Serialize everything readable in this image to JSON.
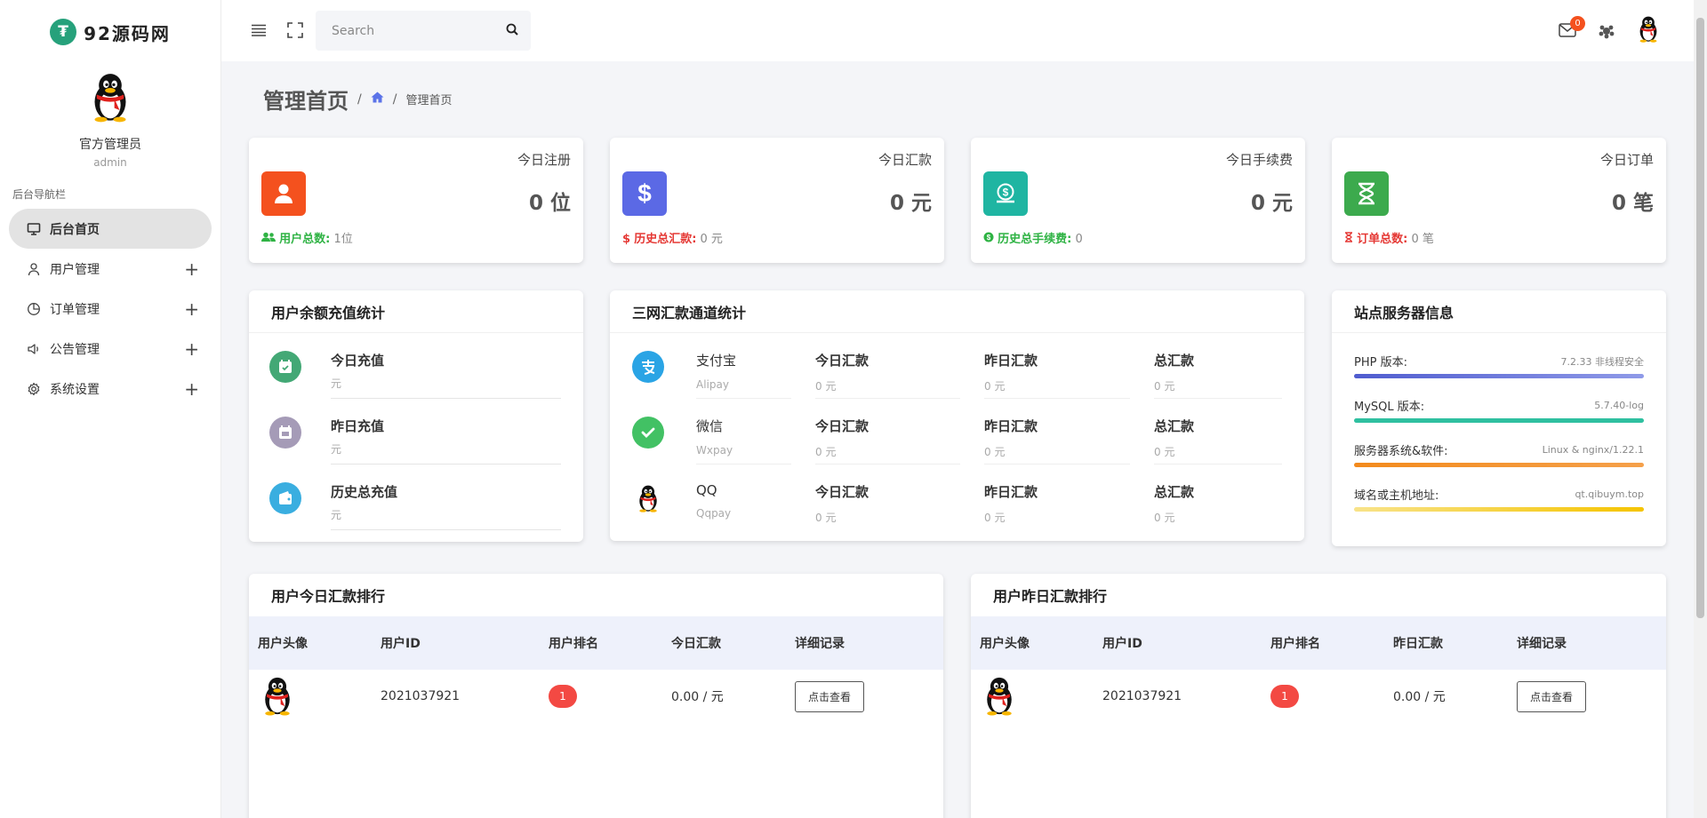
{
  "brand": {
    "logo_char": "₮",
    "name": "92源码网"
  },
  "profile": {
    "name": "官方管理员",
    "role": "admin"
  },
  "nav": {
    "section_label": "后台导航栏",
    "items": [
      {
        "label": "后台首页",
        "icon": "monitor-icon",
        "active": true
      },
      {
        "label": "用户管理",
        "icon": "user-icon",
        "expand": "+"
      },
      {
        "label": "订单管理",
        "icon": "pie-chart-icon",
        "expand": "+"
      },
      {
        "label": "公告管理",
        "icon": "megaphone-icon",
        "expand": "+"
      },
      {
        "label": "系统设置",
        "icon": "gear-icon",
        "expand": "+"
      }
    ]
  },
  "header": {
    "search_placeholder": "Search",
    "mail_badge": "0"
  },
  "page": {
    "title": "管理首页",
    "sep": "/",
    "breadcrumb_current": "管理首页"
  },
  "stats": [
    {
      "label": "今日注册",
      "value": "0 位",
      "color": "#f4511e",
      "foot_key": "用户总数:",
      "foot_val": "1位",
      "foot_color": "#2fb344"
    },
    {
      "label": "今日汇款",
      "value": "0 元",
      "color": "#5b69e5",
      "foot_key": "历史总汇款:",
      "foot_val": "0 元",
      "foot_color": "#e53935"
    },
    {
      "label": "今日手续费",
      "value": "0 元",
      "color": "#1fb5a2",
      "foot_key": "历史总手续费:",
      "foot_val": "0",
      "foot_color": "#2fb344"
    },
    {
      "label": "今日订单",
      "value": "0 笔",
      "color": "#3caa4d",
      "foot_key": "订单总数:",
      "foot_val": "0 笔",
      "foot_color": "#e53935"
    }
  ],
  "recharge": {
    "title": "用户余额充值统计",
    "rows": [
      {
        "name": "今日充值",
        "unit": "元"
      },
      {
        "name": "昨日充值",
        "unit": "元"
      },
      {
        "name": "历史总充值",
        "unit": "元"
      }
    ]
  },
  "channels": {
    "title": "三网汇款通道统计",
    "rows": [
      {
        "name": "支付宝",
        "sub": "Alipay",
        "today_label": "今日汇款",
        "today": "0 元",
        "yest_label": "昨日汇款",
        "yest": "0 元",
        "total_label": "总汇款",
        "total": "0 元"
      },
      {
        "name": "微信",
        "sub": "Wxpay",
        "today_label": "今日汇款",
        "today": "0 元",
        "yest_label": "昨日汇款",
        "yest": "0 元",
        "total_label": "总汇款",
        "total": "0 元"
      },
      {
        "name": "QQ",
        "sub": "Qqpay",
        "today_label": "今日汇款",
        "today": "0 元",
        "yest_label": "昨日汇款",
        "yest": "0 元",
        "total_label": "总汇款",
        "total": "0 元"
      }
    ]
  },
  "server": {
    "title": "站点服务器信息",
    "items": [
      {
        "key": "PHP 版本:",
        "value": "7.2.33 非线程安全"
      },
      {
        "key": "MySQL 版本:",
        "value": "5.7.40-log"
      },
      {
        "key": "服务器系统&软件:",
        "value": "Linux & nginx/1.22.1"
      },
      {
        "key": "域名或主机地址:",
        "value": "qt.qibuym.top"
      }
    ]
  },
  "rank_today": {
    "title": "用户今日汇款排行",
    "headers": [
      "用户头像",
      "用户ID",
      "用户排名",
      "今日汇款",
      "详细记录"
    ],
    "rows": [
      {
        "user_id": "2021037921",
        "rank": "1",
        "amount": "0.00 / 元",
        "action": "点击查看"
      }
    ]
  },
  "rank_yesterday": {
    "title": "用户昨日汇款排行",
    "headers": [
      "用户头像",
      "用户ID",
      "用户排名",
      "昨日汇款",
      "详细记录"
    ],
    "rows": [
      {
        "user_id": "2021037921",
        "rank": "1",
        "amount": "0.00 / 元",
        "action": "点击查看"
      }
    ]
  }
}
